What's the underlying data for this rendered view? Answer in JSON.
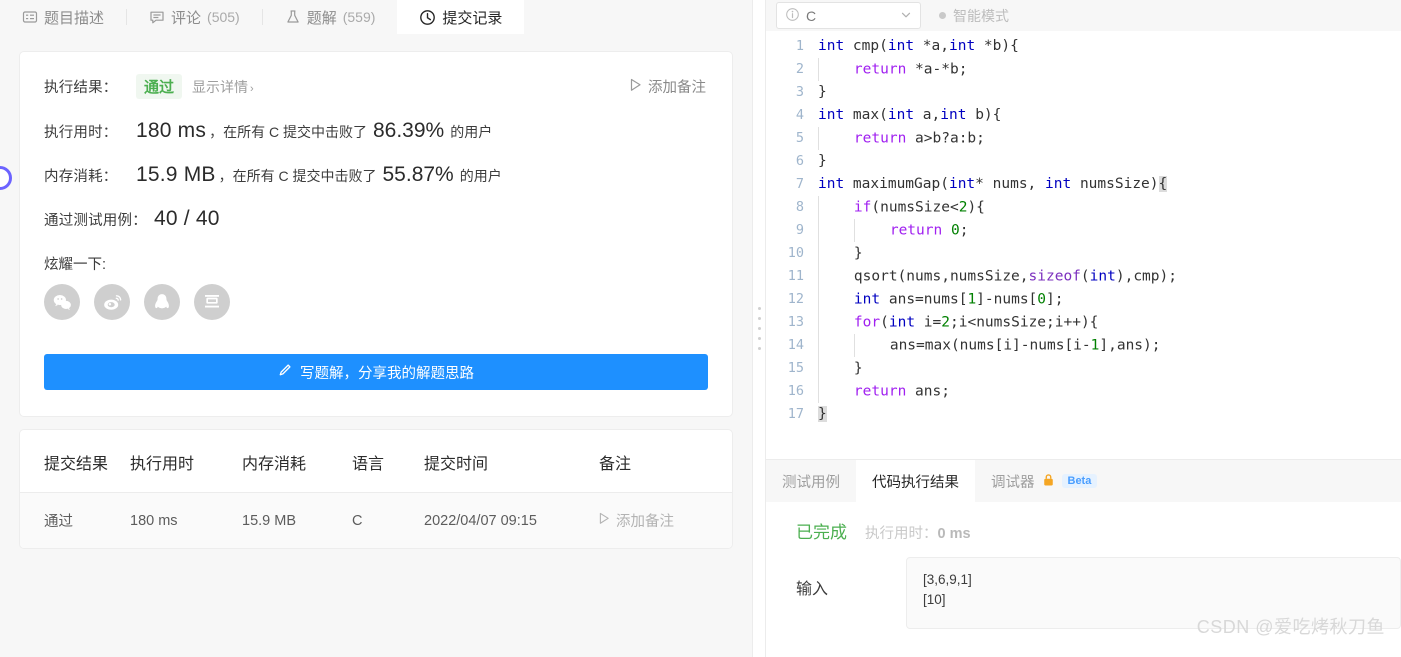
{
  "left": {
    "tabs": [
      {
        "id": "desc",
        "icon": "description-icon",
        "label": "题目描述",
        "count": "",
        "active": false
      },
      {
        "id": "comment",
        "icon": "comment-icon",
        "label": "评论",
        "count": "(505)",
        "active": false
      },
      {
        "id": "solution",
        "icon": "flask-icon",
        "label": "题解",
        "count": "(559)",
        "active": false
      },
      {
        "id": "records",
        "icon": "clock-icon",
        "label": "提交记录",
        "count": "",
        "active": true
      }
    ],
    "result": {
      "result_label": "执行结果：",
      "status": "通过",
      "detail_link": "显示详情",
      "detail_chevron": "›",
      "add_note": "添加备注",
      "runtime_label": "执行用时：",
      "runtime_value": "180 ms",
      "runtime_text": "，在所有 C 提交中击败了",
      "runtime_percent": "86.39%",
      "runtime_suffix": "的用户",
      "memory_label": "内存消耗：",
      "memory_value": "15.9 MB",
      "memory_text": "，在所有 C 提交中击败了",
      "memory_percent": "55.87%",
      "memory_suffix": "的用户",
      "testcase_label": "通过测试用例：",
      "testcase_value": "40 / 40",
      "share_label": "炫耀一下:",
      "share_icons": [
        "wechat-icon",
        "weibo-icon",
        "qq-icon",
        "douban-icon"
      ],
      "write_button": "写题解，分享我的解题思路",
      "write_button_icon": "pencil-icon"
    },
    "history": {
      "headers": [
        "提交结果",
        "执行用时",
        "内存消耗",
        "语言",
        "提交时间",
        "备注"
      ],
      "rows": [
        {
          "status": "通过",
          "runtime": "180 ms",
          "memory": "15.9 MB",
          "language": "C",
          "time": "2022/04/07 09:15",
          "note": "添加备注"
        }
      ]
    }
  },
  "right": {
    "editor_header": {
      "language": "C",
      "info_icon": "info-icon",
      "chevron_icon": "chevron-down-icon",
      "smart_mode": "智能模式"
    },
    "code_lines": [
      {
        "n": "1",
        "indent": 0,
        "tokens": [
          {
            "t": "int",
            "c": "kw"
          },
          {
            "t": " cmp(",
            "c": ""
          },
          {
            "t": "int",
            "c": "kw"
          },
          {
            "t": " *a,",
            "c": ""
          },
          {
            "t": "int",
            "c": "kw"
          },
          {
            "t": " *b){",
            "c": ""
          }
        ]
      },
      {
        "n": "2",
        "indent": 1,
        "tokens": [
          {
            "t": "return",
            "c": "kw2"
          },
          {
            "t": " *a-*b;",
            "c": ""
          }
        ]
      },
      {
        "n": "3",
        "indent": 0,
        "tokens": [
          {
            "t": "}",
            "c": ""
          }
        ]
      },
      {
        "n": "4",
        "indent": 0,
        "tokens": [
          {
            "t": "int",
            "c": "kw"
          },
          {
            "t": " max(",
            "c": ""
          },
          {
            "t": "int",
            "c": "kw"
          },
          {
            "t": " a,",
            "c": ""
          },
          {
            "t": "int",
            "c": "kw"
          },
          {
            "t": " b){",
            "c": ""
          }
        ]
      },
      {
        "n": "5",
        "indent": 1,
        "tokens": [
          {
            "t": "return",
            "c": "kw2"
          },
          {
            "t": " a>b?a:b;",
            "c": ""
          }
        ]
      },
      {
        "n": "6",
        "indent": 0,
        "tokens": [
          {
            "t": "}",
            "c": ""
          }
        ]
      },
      {
        "n": "7",
        "indent": 0,
        "tokens": [
          {
            "t": "int",
            "c": "kw"
          },
          {
            "t": " maximumGap(",
            "c": ""
          },
          {
            "t": "int",
            "c": "kw"
          },
          {
            "t": "* nums, ",
            "c": ""
          },
          {
            "t": "int",
            "c": "kw"
          },
          {
            "t": " numsSize)",
            "c": ""
          },
          {
            "t": "{",
            "c": "brmatch"
          }
        ]
      },
      {
        "n": "8",
        "indent": 1,
        "tokens": [
          {
            "t": "if",
            "c": "kw2"
          },
          {
            "t": "(numsSize<",
            "c": ""
          },
          {
            "t": "2",
            "c": "num"
          },
          {
            "t": "){",
            "c": ""
          }
        ]
      },
      {
        "n": "9",
        "indent": 2,
        "tokens": [
          {
            "t": "return",
            "c": "kw2"
          },
          {
            "t": " ",
            "c": ""
          },
          {
            "t": "0",
            "c": "num"
          },
          {
            "t": ";",
            "c": ""
          }
        ]
      },
      {
        "n": "10",
        "indent": 1,
        "tokens": [
          {
            "t": "}",
            "c": ""
          }
        ]
      },
      {
        "n": "11",
        "indent": 1,
        "tokens": [
          {
            "t": "qsort(nums,numsSize,",
            "c": ""
          },
          {
            "t": "sizeof",
            "c": "kw3"
          },
          {
            "t": "(",
            "c": ""
          },
          {
            "t": "int",
            "c": "kw"
          },
          {
            "t": "),cmp);",
            "c": ""
          }
        ]
      },
      {
        "n": "12",
        "indent": 1,
        "tokens": [
          {
            "t": "int",
            "c": "kw"
          },
          {
            "t": " ans=nums[",
            "c": ""
          },
          {
            "t": "1",
            "c": "num"
          },
          {
            "t": "]-nums[",
            "c": ""
          },
          {
            "t": "0",
            "c": "num"
          },
          {
            "t": "];",
            "c": ""
          }
        ]
      },
      {
        "n": "13",
        "indent": 1,
        "tokens": [
          {
            "t": "for",
            "c": "kw2"
          },
          {
            "t": "(",
            "c": ""
          },
          {
            "t": "int",
            "c": "kw"
          },
          {
            "t": " i=",
            "c": ""
          },
          {
            "t": "2",
            "c": "num"
          },
          {
            "t": ";i<numsSize;i++){",
            "c": ""
          }
        ]
      },
      {
        "n": "14",
        "indent": 2,
        "tokens": [
          {
            "t": "ans=max(nums[i]-nums[i-",
            "c": ""
          },
          {
            "t": "1",
            "c": "num"
          },
          {
            "t": "],ans);",
            "c": ""
          }
        ]
      },
      {
        "n": "15",
        "indent": 1,
        "tokens": [
          {
            "t": "}",
            "c": ""
          }
        ]
      },
      {
        "n": "16",
        "indent": 1,
        "tokens": [
          {
            "t": "return",
            "c": "kw2"
          },
          {
            "t": " ans;",
            "c": ""
          }
        ]
      },
      {
        "n": "17",
        "indent": 0,
        "tokens": [
          {
            "t": "}",
            "c": "brmatch"
          }
        ]
      }
    ],
    "console": {
      "tabs": [
        {
          "id": "testcase",
          "label": "测试用例",
          "active": false,
          "lock": false,
          "beta": ""
        },
        {
          "id": "result",
          "label": "代码执行结果",
          "active": true,
          "lock": false,
          "beta": ""
        },
        {
          "id": "debugger",
          "label": "调试器",
          "active": false,
          "lock": true,
          "beta": "Beta"
        }
      ],
      "status": "已完成",
      "runtime_label": "执行用时：",
      "runtime_value": "0 ms",
      "input_label": "输入",
      "input_value": "[3,6,9,1]\n[10]"
    }
  },
  "watermark": "CSDN @爱吃烤秋刀鱼",
  "colors": {
    "accent_blue": "#1e90ff",
    "pass_green": "#4caf50",
    "beta_blue": "#4a9eff",
    "lock_orange": "#f5a623"
  }
}
